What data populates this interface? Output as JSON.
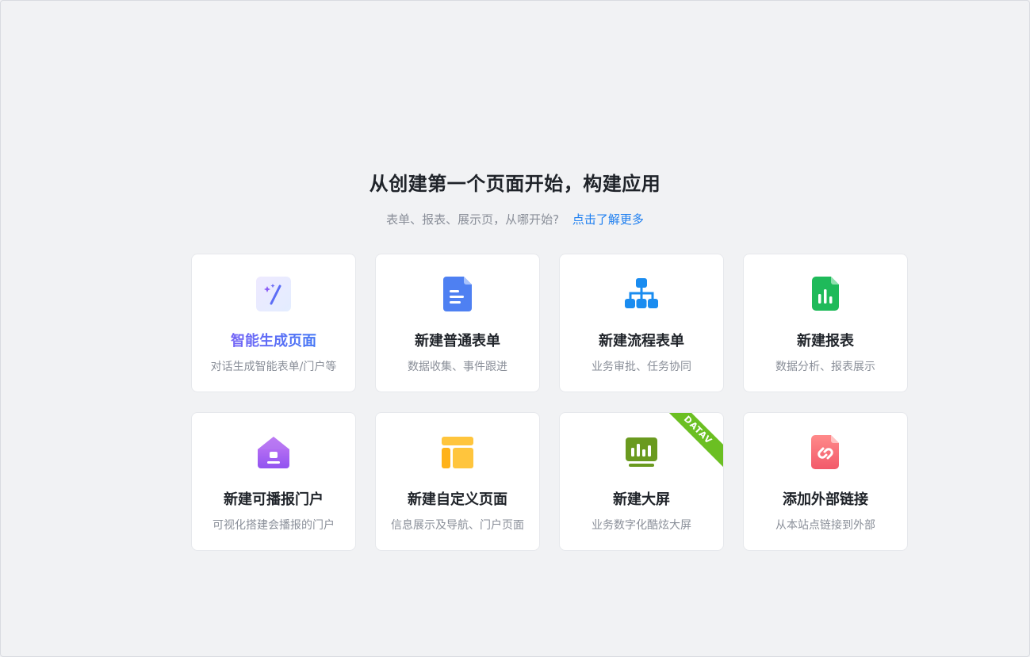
{
  "heading": "从创建第一个页面开始，构建应用",
  "subline": {
    "text": "表单、报表、展示页，从哪开始?",
    "link": "点击了解更多"
  },
  "cards": [
    {
      "title": "智能生成页面",
      "desc": "对话生成智能表单/门户等",
      "icon": "magic-wand-icon"
    },
    {
      "title": "新建普通表单",
      "desc": "数据收集、事件跟进",
      "icon": "document-icon"
    },
    {
      "title": "新建流程表单",
      "desc": "业务审批、任务协同",
      "icon": "flowchart-icon"
    },
    {
      "title": "新建报表",
      "desc": "数据分析、报表展示",
      "icon": "report-chart-icon"
    },
    {
      "title": "新建可播报门户",
      "desc": "可视化搭建会播报的门户",
      "icon": "house-icon"
    },
    {
      "title": "新建自定义页面",
      "desc": "信息展示及导航、门户页面",
      "icon": "layout-icon"
    },
    {
      "title": "新建大屏",
      "desc": "业务数字化酷炫大屏",
      "icon": "dashboard-screen-icon",
      "badge": "DATAV"
    },
    {
      "title": "添加外部链接",
      "desc": "从本站点链接到外部",
      "icon": "link-icon"
    }
  ],
  "colors": {
    "accent": "#1e7ff0",
    "ribbon": "#6bbf22",
    "background": "#f1f2f4"
  }
}
